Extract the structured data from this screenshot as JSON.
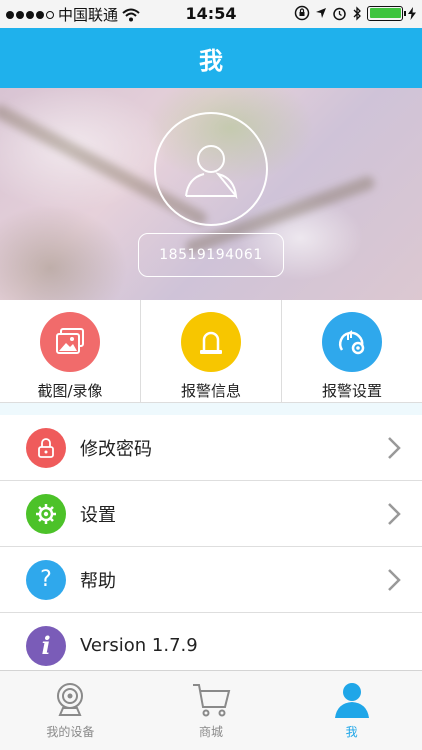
{
  "status_bar": {
    "carrier": "中国联通",
    "time": "14:54",
    "signal_dots_filled": 4,
    "signal_dots_total": 5,
    "battery_level": 1.0
  },
  "nav": {
    "title": "我"
  },
  "profile": {
    "phone": "18519194061"
  },
  "quick_actions": [
    {
      "label": "截图/录像",
      "color": "#f16b6b",
      "icon": "photo-icon"
    },
    {
      "label": "报警信息",
      "color": "#f7c600",
      "icon": "alarm-light-icon"
    },
    {
      "label": "报警设置",
      "color": "#2fa8ec",
      "icon": "alarm-settings-icon"
    }
  ],
  "menu": [
    {
      "label": "修改密码",
      "color": "#ef5b5b",
      "icon": "lock-icon"
    },
    {
      "label": "设置",
      "color": "#4cc229",
      "icon": "gear-icon"
    },
    {
      "label": "帮助",
      "color": "#2fa8ec",
      "icon": "question-icon"
    },
    {
      "label": "Version 1.7.9",
      "color": "#7a5cb8",
      "icon": "info-icon"
    }
  ],
  "tabs": [
    {
      "label": "我的设备",
      "icon": "camera-icon"
    },
    {
      "label": "商城",
      "icon": "cart-icon"
    },
    {
      "label": "我",
      "icon": "user-icon",
      "active": true
    }
  ],
  "colors": {
    "brand": "#1fb1ec",
    "tab_active": "#1fa6e8",
    "tab_inactive": "#8a8a8a"
  }
}
